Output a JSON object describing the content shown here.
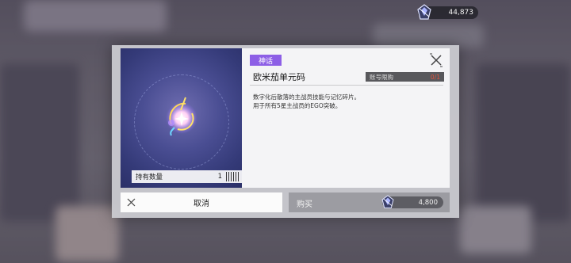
{
  "currency": {
    "icon": "crystal-gem-icon",
    "amount": "44,873"
  },
  "item": {
    "rarity": "神话",
    "name": "欧米茄单元码",
    "limit_label": "账号限购",
    "limit_value": "0/1",
    "description_lines": [
      "数字化后散落的主战员技能与记忆碎片。",
      "用于所有5星主战员的EGO突破。"
    ],
    "owned_label": "持有数量",
    "owned_count": "1"
  },
  "actions": {
    "cancel_label": "取消",
    "buy_label": "购买",
    "price": "4,800"
  },
  "colors": {
    "rarity": "#8d5fe6",
    "limit_ratio": "#e5533c"
  }
}
